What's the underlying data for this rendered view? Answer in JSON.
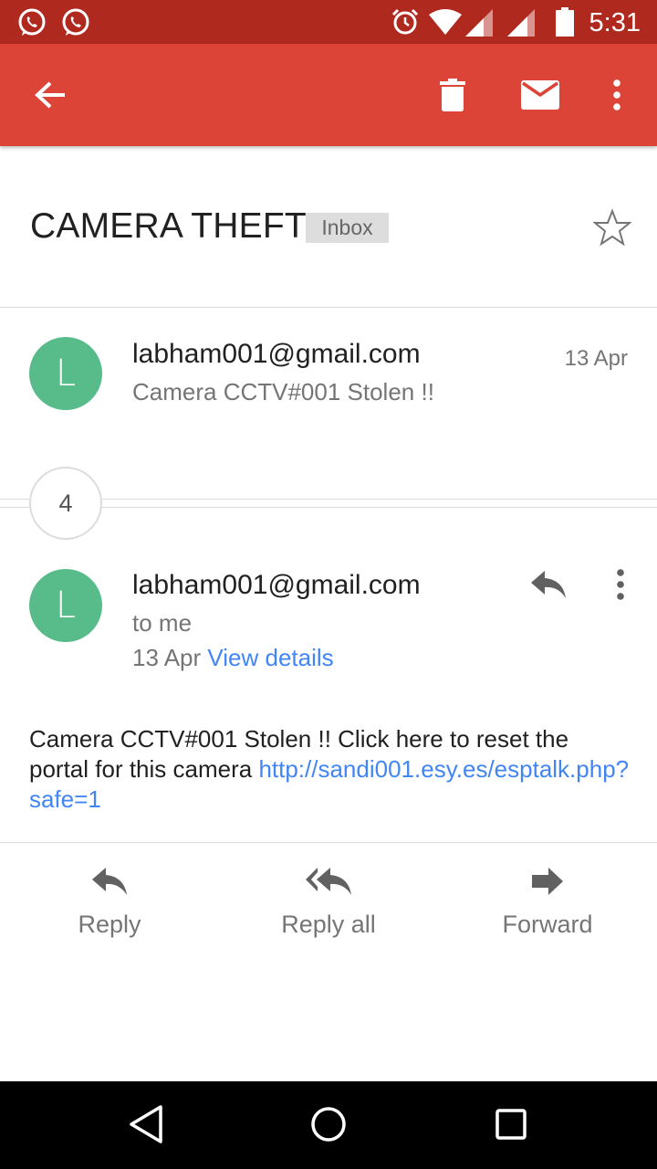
{
  "status_bar": {
    "time": "5:31",
    "icons": [
      "whatsapp-icon",
      "whatsapp-icon",
      "alarm-icon",
      "wifi-icon",
      "signal-icon",
      "signal-icon",
      "battery-icon"
    ]
  },
  "app_bar": {
    "back_icon": "arrow-back-icon",
    "actions": [
      "delete-icon",
      "mark-unread-icon",
      "more-vert-icon"
    ],
    "color": "#db4437"
  },
  "thread": {
    "subject": "CAMERA THEFT",
    "label": "Inbox"
  },
  "collapsed_message": {
    "avatar_letter": "L",
    "sender": "labham001@gmail.com",
    "snippet": "Camera CCTV#001 Stolen !!",
    "date": "13 Apr"
  },
  "hidden_count": "4",
  "expanded_message": {
    "avatar_letter": "L",
    "sender": "labham001@gmail.com",
    "recipient": "to me",
    "date": "13 Apr",
    "details_link": "View details",
    "body_text": "Camera CCTV#001 Stolen !! Click here to reset the portal for this camera ",
    "body_link": "http://sandi001.esy.es/esptalk.php?safe=1"
  },
  "actions": {
    "reply": "Reply",
    "reply_all": "Reply all",
    "forward": "Forward"
  },
  "colors": {
    "avatar": "#57bb8a",
    "link": "#4285f4",
    "status_bar": "#b0291f"
  }
}
